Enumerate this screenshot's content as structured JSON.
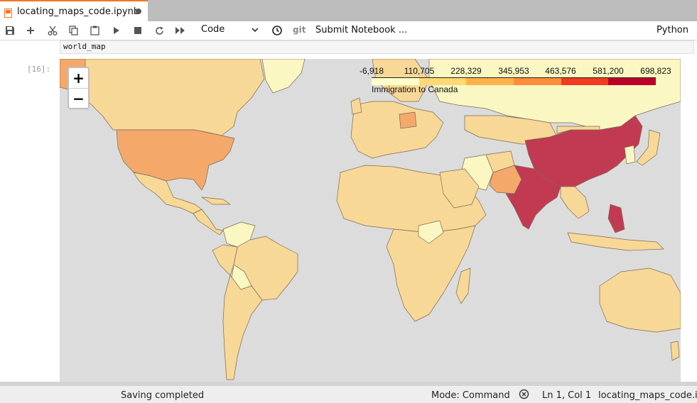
{
  "tab": {
    "title": "locating_maps_code.ipynb"
  },
  "toolbar": {
    "cell_type": "Code",
    "git_label": "git",
    "submit_label": "Submit Notebook ...",
    "kernel_name": "Python"
  },
  "cell": {
    "source": "world_map",
    "prompt": "[16]:"
  },
  "map": {
    "legend": {
      "ticks": [
        "-6,918",
        "110,705",
        "228,329",
        "345,953",
        "463,576",
        "581,200",
        "698,823"
      ],
      "caption": "Immigration to Canada",
      "colors": [
        "#ffffcc",
        "#fed976",
        "#feb24c",
        "#fd8d3c",
        "#f03b20",
        "#bd0026"
      ]
    },
    "zoom_in": "+",
    "zoom_out": "−",
    "country_colors": {
      "ocean": "#dcdcdc",
      "low": "#f8d896",
      "lowest": "#fbf7c2",
      "mid": "#f4a86a",
      "high": "#c23a52"
    }
  },
  "status": {
    "message": "Saving completed",
    "mode": "Mode: Command",
    "position": "Ln 1, Col 1",
    "filename": "locating_maps_code.ipy"
  }
}
